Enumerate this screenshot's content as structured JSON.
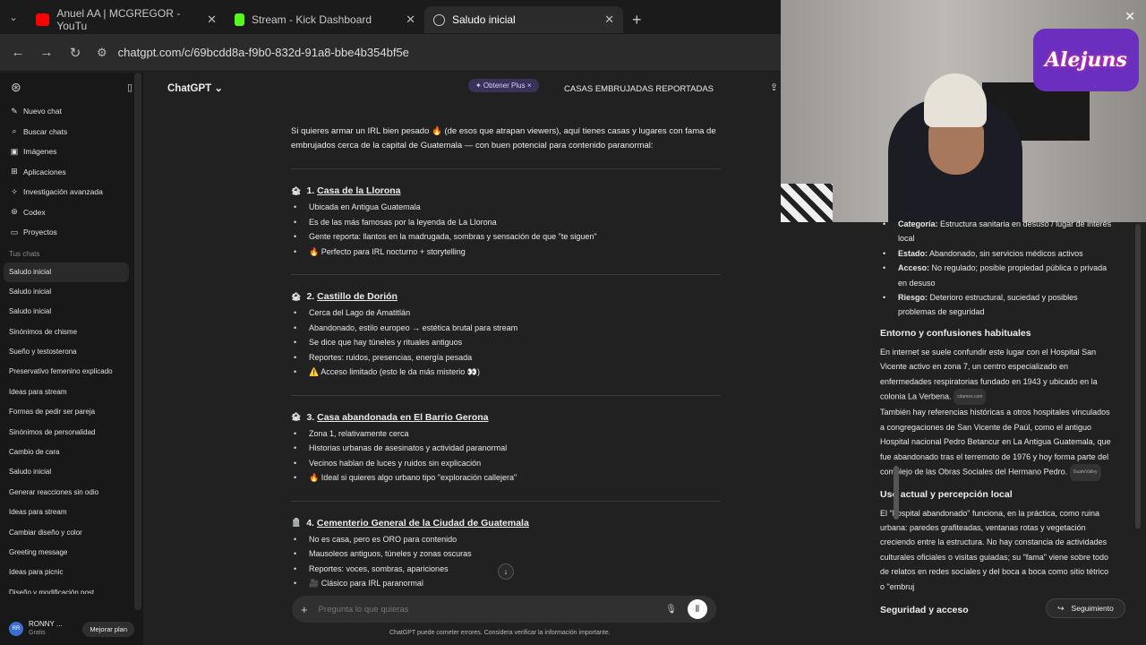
{
  "browser": {
    "tabs": [
      {
        "title": "Anuel AA | MCGREGOR - YouTu",
        "icon": "youtube-icon",
        "color": "#ff0000"
      },
      {
        "title": "Stream - Kick Dashboard",
        "icon": "kick-icon",
        "color": "#53fc18"
      },
      {
        "title": "Saludo inicial",
        "icon": "openai-icon",
        "color": "#cccccc"
      }
    ],
    "url": "chatgpt.com/c/69bcdd8a-f9b0-832d-91a8-bbe4b354bf5e"
  },
  "sidebar": {
    "items": [
      {
        "label": "Nuevo chat",
        "icon": "edit-icon",
        "glyph": "✎"
      },
      {
        "label": "Buscar chats",
        "icon": "search-icon",
        "glyph": "⌕"
      },
      {
        "label": "Imágenes",
        "icon": "image-icon",
        "glyph": "▣"
      },
      {
        "label": "Aplicaciones",
        "icon": "apps-icon",
        "glyph": "⊞"
      },
      {
        "label": "Investigación avanzada",
        "icon": "research-icon",
        "glyph": "✧"
      },
      {
        "label": "Codex",
        "icon": "codex-icon",
        "glyph": "⊛"
      },
      {
        "label": "Proyectos",
        "icon": "folder-icon",
        "glyph": "▭"
      }
    ],
    "section_label": "Tus chats",
    "chats": [
      "Saludo inicial",
      "Saludo inicial",
      "Saludo inicial",
      "Sinónimos de chisme",
      "Sueño y testosterona",
      "Preservativo femenino explicado",
      "Ideas para stream",
      "Formas de pedir ser pareja",
      "Sinónimos de personalidad",
      "Cambio de cara",
      "Saludo inicial",
      "Generar reacciones sin odio",
      "Ideas para stream",
      "Cambiar diseño y color",
      "Greeting message",
      "Ideas para picnic",
      "Diseño y modificación post"
    ],
    "user": {
      "initials": "RR",
      "name": "RONNY ...",
      "plan": "Gratis",
      "upgrade": "Mejorar plan"
    }
  },
  "header": {
    "model": "ChatGPT ⌄",
    "get_plus": "✦ Obtener Plus  ×",
    "conversation_title": "CASAS EMBRUJADAS REPORTADAS"
  },
  "chat": {
    "intro": "Si quieres armar un IRL bien pesado 🔥 (de esos que atrapan viewers), aquí tienes casas y lugares con fama de embrujados cerca de la capital de Guatemala — con buen potencial para contenido paranormal:",
    "sections": [
      {
        "emoji": "🏚",
        "num": "1.",
        "title": "Casa de la Llorona",
        "bullets": [
          "Ubicada en Antigua Guatemala",
          "Es de las más famosas por la leyenda de La Llorona",
          "Gente reporta: llantos en la madrugada, sombras y sensación de que \"te siguen\"",
          "🔥 Perfecto para IRL nocturno + storytelling"
        ]
      },
      {
        "emoji": "🏚",
        "num": "2.",
        "title": "Castillo de Dorión",
        "bullets": [
          "Cerca del Lago de Amatitlán",
          "Abandonado, estilo europeo → estética brutal para stream",
          "Se dice que hay túneles y rituales antiguos",
          "Reportes: ruidos, presencias, energía pesada",
          "⚠️ Acceso limitado (esto le da más misterio 👀)"
        ]
      },
      {
        "emoji": "🏚",
        "num": "3.",
        "title": "Casa abandonada en El Barrio Gerona",
        "bullets": [
          "Zona 1, relativamente cerca",
          "Historias urbanas de asesinatos y actividad paranormal",
          "Vecinos hablan de luces y ruidos sin explicación",
          "🔥 Ideal si quieres algo urbano tipo \"exploración callejera\""
        ]
      },
      {
        "emoji": "🪦",
        "num": "4.",
        "title": "Cementerio General de la Ciudad de Guatemala",
        "bullets": [
          "No es casa, pero es ORO para contenido",
          "Mausoleos antiguos, túneles y zonas oscuras",
          "Reportes: voces, sombras, apariciones",
          "🎥 Clásico para IRL paranormal"
        ]
      }
    ],
    "composer_placeholder": "Pregunta lo que quieras",
    "disclaimer": "ChatGPT puede cometer errores. Considera verificar la información importante."
  },
  "stream_overlay": {
    "logo_text": "Alejuns"
  },
  "side_panel": {
    "bullets": [
      {
        "label": "Categoría:",
        "text": " Estructura sanitaria en desuso / lugar de interés local"
      },
      {
        "label": "Estado:",
        "text": " Abandonado, sin servicios médicos activos"
      },
      {
        "label": "Acceso:",
        "text": " No regulado; posible propiedad pública o privada en desuso"
      },
      {
        "label": "Riesgo:",
        "text": " Deterioro estructural, suciedad y posibles problemas de seguridad"
      }
    ],
    "h1": "Entorno y confusiones habituales",
    "p1": "En internet se suele confundir este lugar con el Hospital San Vicente activo en zona 7, un centro especializado en enfermedades respiratorias fundado en 1943 y ubicado en la colonia La Verbena.",
    "src1": "cdamex.com",
    "p2": "También hay referencias históricas a otros hospitales vinculados a congregaciones de San Vicente de Paúl, como el antiguo Hospital nacional Pedro Betancur en La Antigua Guatemala, que fue abandonado tras el terremoto de 1976 y hoy forma parte del complejo de las Obras Sociales del Hermano Pedro.",
    "src2": "GuateValley",
    "h2": "Uso actual y percepción local",
    "p3": "El \"hospital abandonado\" funciona, en la práctica, como ruina urbana: paredes grafiteadas, ventanas rotas y vegetación creciendo entre la estructura. No hay constancia de actividades culturales oficiales o visitas guiadas; su \"fama\" viene sobre todo de relatos en redes sociales y del boca a boca como sitio tétrico o \"embruj",
    "h3": "Seguridad y acceso",
    "follow_button": "Seguimiento"
  }
}
